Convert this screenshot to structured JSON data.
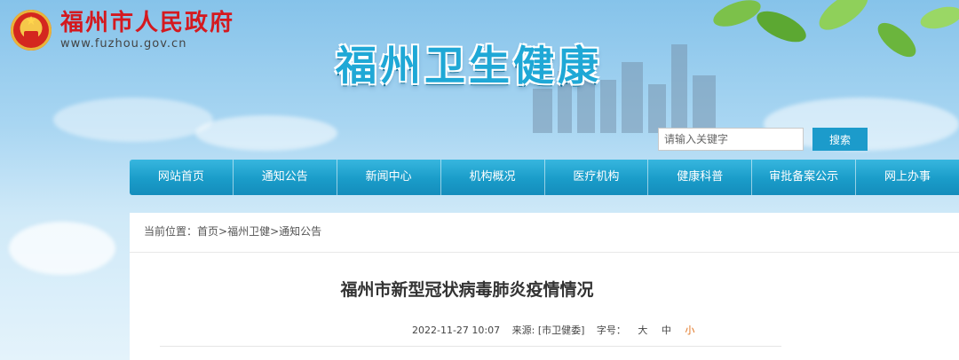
{
  "gov": {
    "title": "福州市人民政府",
    "url": "www.fuzhou.gov.cn"
  },
  "site": {
    "title": "福州卫生健康"
  },
  "search": {
    "placeholder": "请输入关键字",
    "button_label": "搜索"
  },
  "nav": {
    "items": [
      {
        "label": "网站首页"
      },
      {
        "label": "通知公告"
      },
      {
        "label": "新闻中心"
      },
      {
        "label": "机构概况"
      },
      {
        "label": "医疗机构"
      },
      {
        "label": "健康科普"
      },
      {
        "label": "审批备案公示"
      },
      {
        "label": "网上办事"
      }
    ]
  },
  "breadcrumb": {
    "prefix": "当前位置：",
    "items": [
      "首页",
      "福州卫健",
      "通知公告"
    ],
    "separator": ">"
  },
  "article": {
    "title": "福州市新型冠状病毒肺炎疫情情况",
    "date": "2022-11-27 10:07",
    "source": "来源: [市卫健委]",
    "font_label": "字号：",
    "font_sizes": [
      "大",
      "中",
      "小"
    ],
    "active_font_size": "小"
  },
  "colors": {
    "nav": "#1a9cc9",
    "gov_title": "#d4191f",
    "accent": "#e0701a"
  }
}
